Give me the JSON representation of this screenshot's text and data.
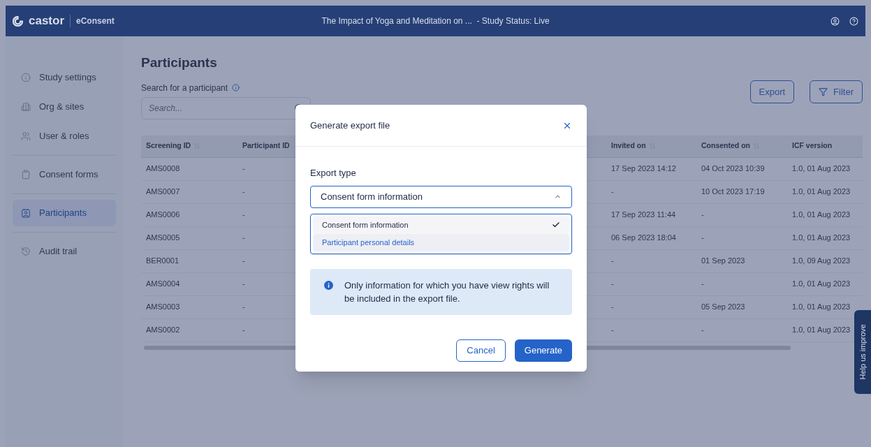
{
  "header": {
    "logo": "castor",
    "product": "eConsent",
    "title": "The Impact of Yoga and Meditation on ...  - Study Status: Live"
  },
  "sidebar": {
    "groups": [
      [
        {
          "label": "Study settings",
          "selected": false
        },
        {
          "label": "Org & sites",
          "selected": false
        },
        {
          "label": "User & roles",
          "selected": false
        }
      ],
      [
        {
          "label": "Consent forms",
          "selected": false
        }
      ],
      [
        {
          "label": "Participants",
          "selected": true
        }
      ],
      [
        {
          "label": "Audit trail",
          "selected": false
        }
      ]
    ]
  },
  "page": {
    "title": "Participants",
    "search": {
      "label": "Search for a participant",
      "placeholder": "Search..."
    },
    "buttons": [
      {
        "kind": "plain",
        "label": "Export"
      },
      {
        "kind": "filter",
        "label": "Filter"
      }
    ]
  },
  "table": {
    "columns": [
      {
        "label": "Screening ID",
        "sortable": true
      },
      {
        "label": "Participant ID",
        "sortable": false
      },
      {
        "label": "Invited on",
        "sortable": true
      },
      {
        "label": "Consented on",
        "sortable": true
      },
      {
        "label": "ICF version",
        "sortable": false
      }
    ],
    "rows": [
      [
        "AMS0008",
        "-",
        "17 Sep 2023 14:12",
        "04 Oct 2023 10:39",
        "1.0, 01 Aug 2023"
      ],
      [
        "AMS0007",
        "-",
        "-",
        "10 Oct 2023 17:19",
        "1.0, 01 Aug 2023"
      ],
      [
        "AMS0006",
        "-",
        "17 Sep 2023 11:44",
        "-",
        "1.0, 01 Aug 2023"
      ],
      [
        "AMS0005",
        "-",
        "06 Sep 2023 18:04",
        "-",
        "1.0, 01 Aug 2023"
      ],
      [
        "BER0001",
        "-",
        "-",
        "01 Sep 2023",
        "1.0, 09 Aug 2023"
      ],
      [
        "AMS0004",
        "-",
        "-",
        "-",
        "1.0, 01 Aug 2023"
      ],
      [
        "AMS0003",
        "-",
        "-",
        "05 Sep 2023",
        "1.0, 01 Aug 2023"
      ],
      [
        "AMS0002",
        "-",
        "-",
        "-",
        "1.0, 01 Aug 2023"
      ]
    ]
  },
  "feedback_tab": "Help us improve",
  "modal": {
    "title": "Generate export file",
    "field_label": "Export type",
    "select": {
      "value": "Consent form information",
      "expanded": true,
      "options": [
        {
          "label": "Consent form information",
          "selected": true,
          "hovered": false
        },
        {
          "label": "Participant personal details",
          "selected": false,
          "hovered": true
        }
      ]
    },
    "info": "Only information for which you have view rights will be included in the export file.",
    "buttons": [
      {
        "kind": "secondary",
        "label": "Cancel"
      },
      {
        "kind": "primary",
        "label": "Generate"
      }
    ]
  }
}
